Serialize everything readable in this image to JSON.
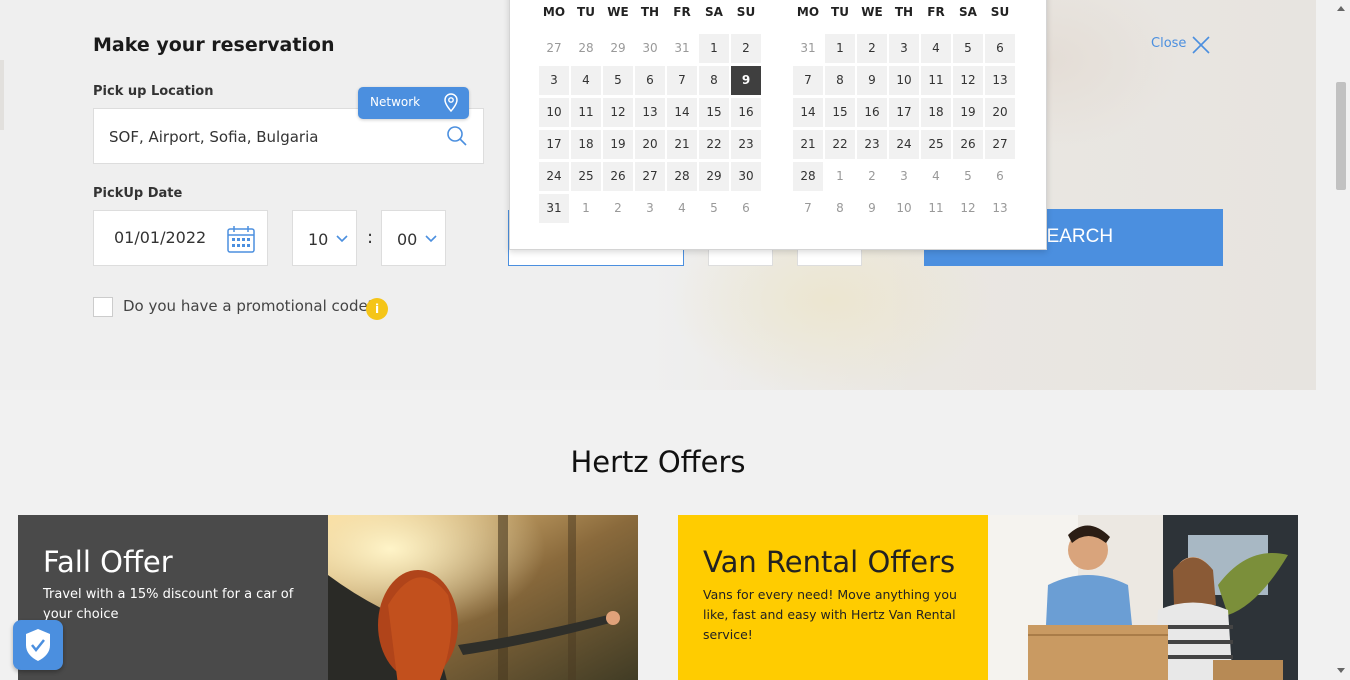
{
  "reservation": {
    "title": "Make your reservation",
    "pickup_location_label": "Pick up Location",
    "pickup_location_value": "SOF, Airport, Sofia, Bulgaria",
    "network_label": "Network",
    "pickup_date_label": "PickUp Date",
    "pickup_date_value": "01/01/2022",
    "pickup_hour": "10",
    "pickup_minute": "00",
    "time_separator": ":",
    "promo_label": "Do you have a promotional code?",
    "info_badge": "i",
    "search_label": "SEARCH",
    "close_label": "Close"
  },
  "calendar": {
    "weekdays": [
      "MO",
      "TU",
      "WE",
      "TH",
      "FR",
      "SA",
      "SU"
    ],
    "months": [
      {
        "days": [
          [
            "27",
            "other"
          ],
          [
            "28",
            "other"
          ],
          [
            "29",
            "other"
          ],
          [
            "30",
            "other"
          ],
          [
            "31",
            "other"
          ],
          [
            "1",
            ""
          ],
          [
            "2",
            ""
          ],
          [
            "3",
            ""
          ],
          [
            "4",
            ""
          ],
          [
            "5",
            ""
          ],
          [
            "6",
            ""
          ],
          [
            "7",
            ""
          ],
          [
            "8",
            ""
          ],
          [
            "9",
            "sel"
          ],
          [
            "10",
            ""
          ],
          [
            "11",
            ""
          ],
          [
            "12",
            ""
          ],
          [
            "13",
            ""
          ],
          [
            "14",
            ""
          ],
          [
            "15",
            ""
          ],
          [
            "16",
            ""
          ],
          [
            "17",
            ""
          ],
          [
            "18",
            ""
          ],
          [
            "19",
            ""
          ],
          [
            "20",
            ""
          ],
          [
            "21",
            ""
          ],
          [
            "22",
            ""
          ],
          [
            "23",
            ""
          ],
          [
            "24",
            ""
          ],
          [
            "25",
            ""
          ],
          [
            "26",
            ""
          ],
          [
            "27",
            ""
          ],
          [
            "28",
            ""
          ],
          [
            "29",
            ""
          ],
          [
            "30",
            ""
          ],
          [
            "31",
            ""
          ],
          [
            "1",
            "other"
          ],
          [
            "2",
            "other"
          ],
          [
            "3",
            "other"
          ],
          [
            "4",
            "other"
          ],
          [
            "5",
            "other"
          ],
          [
            "6",
            "other"
          ]
        ]
      },
      {
        "days": [
          [
            "31",
            "other"
          ],
          [
            "1",
            ""
          ],
          [
            "2",
            ""
          ],
          [
            "3",
            ""
          ],
          [
            "4",
            ""
          ],
          [
            "5",
            ""
          ],
          [
            "6",
            ""
          ],
          [
            "7",
            ""
          ],
          [
            "8",
            ""
          ],
          [
            "9",
            ""
          ],
          [
            "10",
            ""
          ],
          [
            "11",
            ""
          ],
          [
            "12",
            ""
          ],
          [
            "13",
            ""
          ],
          [
            "14",
            ""
          ],
          [
            "15",
            ""
          ],
          [
            "16",
            ""
          ],
          [
            "17",
            ""
          ],
          [
            "18",
            ""
          ],
          [
            "19",
            ""
          ],
          [
            "20",
            ""
          ],
          [
            "21",
            ""
          ],
          [
            "22",
            ""
          ],
          [
            "23",
            ""
          ],
          [
            "24",
            ""
          ],
          [
            "25",
            ""
          ],
          [
            "26",
            ""
          ],
          [
            "27",
            ""
          ],
          [
            "28",
            ""
          ],
          [
            "1",
            "other"
          ],
          [
            "2",
            "other"
          ],
          [
            "3",
            "other"
          ],
          [
            "4",
            "other"
          ],
          [
            "5",
            "other"
          ],
          [
            "6",
            "other"
          ],
          [
            "7",
            "other"
          ],
          [
            "8",
            "other"
          ],
          [
            "9",
            "other"
          ],
          [
            "10",
            "other"
          ],
          [
            "11",
            "other"
          ],
          [
            "12",
            "other"
          ],
          [
            "13",
            "other"
          ]
        ]
      }
    ]
  },
  "offers": {
    "title": "Hertz Offers",
    "cards": [
      {
        "title": "Fall Offer",
        "text": "Travel with a 15% discount for a car of your choice"
      },
      {
        "title": "Van Rental Offers",
        "text": "Vans for every need! Move anything you like, fast and easy with Hertz Van Rental service!"
      }
    ]
  },
  "colors": {
    "accent": "#4b8fdf",
    "yellow": "#ffcc00",
    "dark": "#4a4a4a",
    "selected_day": "#3f3f3f"
  }
}
